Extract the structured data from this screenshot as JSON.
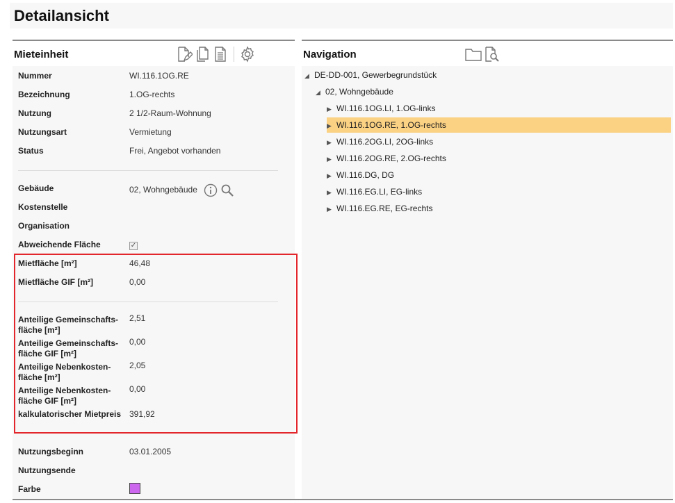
{
  "page": {
    "title": "Detailansicht"
  },
  "mieteinheit": {
    "title": "Mieteinheit",
    "fields": {
      "nummer": {
        "label": "Nummer",
        "value": "WI.116.1OG.RE"
      },
      "bezeichnung": {
        "label": "Bezeichnung",
        "value": "1.OG-rechts"
      },
      "nutzung": {
        "label": "Nutzung",
        "value": "2 1/2-Raum-Wohnung"
      },
      "nutzungsart": {
        "label": "Nutzungsart",
        "value": "Vermietung"
      },
      "status": {
        "label": "Status",
        "value": "Frei, Angebot vorhanden"
      },
      "gebaeude": {
        "label": "Gebäude",
        "value": "02, Wohngebäude"
      },
      "kostenstelle": {
        "label": "Kostenstelle",
        "value": ""
      },
      "organisation": {
        "label": "Organisation",
        "value": ""
      },
      "abweichende_flaeche": {
        "label": "Abweichende Fläche",
        "checked": true,
        "check_glyph": "✓"
      },
      "mietflaeche": {
        "label": "Mietfläche [m²]",
        "value": "46,48"
      },
      "mietflaeche_gif": {
        "label": "Mietfläche GIF [m²]",
        "value": "0,00"
      },
      "ant_gemein": {
        "label_1": "Anteilige Gemeinschafts-",
        "label_2": "fläche [m²]",
        "value": "2,51"
      },
      "ant_gemein_gif": {
        "label_1": "Anteilige Gemeinschafts-",
        "label_2": "fläche GIF [m²]",
        "value": "0,00"
      },
      "ant_neben": {
        "label_1": "Anteilige Nebenkosten-",
        "label_2": "fläche [m²]",
        "value": "2,05"
      },
      "ant_neben_gif": {
        "label_1": "Anteilige Nebenkosten-",
        "label_2": "fläche GIF [m²]",
        "value": "0,00"
      },
      "mietpreis": {
        "label": "kalkulatorischer Mietpreis",
        "value": "391,92"
      },
      "nutzungsbeginn": {
        "label": "Nutzungsbeginn",
        "value": "03.01.2005"
      },
      "nutzungsende": {
        "label": "Nutzungsende",
        "value": ""
      },
      "farbe": {
        "label": "Farbe",
        "color": "#cc66ee"
      }
    }
  },
  "navigation": {
    "title": "Navigation",
    "expanded_glyph": "◢",
    "collapsed_glyph": "▶",
    "root": "DE-DD-001, Gewerbegrundstück",
    "building": "02, Wohngebäude",
    "units": [
      {
        "label": "WI.116.1OG.LI, 1.OG-links"
      },
      {
        "label": "WI.116.1OG.RE, 1.OG-rechts",
        "selected": true
      },
      {
        "label": "WI.116.2OG.LI, 2OG-links"
      },
      {
        "label": "WI.116.2OG.RE, 2.OG-rechts"
      },
      {
        "label": "WI.116.DG, DG"
      },
      {
        "label": "WI.116.EG.LI, EG-links"
      },
      {
        "label": "WI.116.EG.RE, EG-rechts"
      }
    ]
  },
  "colors": {
    "highlight": "#fbd183",
    "red_frame": "#e3262b",
    "swatch": "#cc66ee"
  }
}
